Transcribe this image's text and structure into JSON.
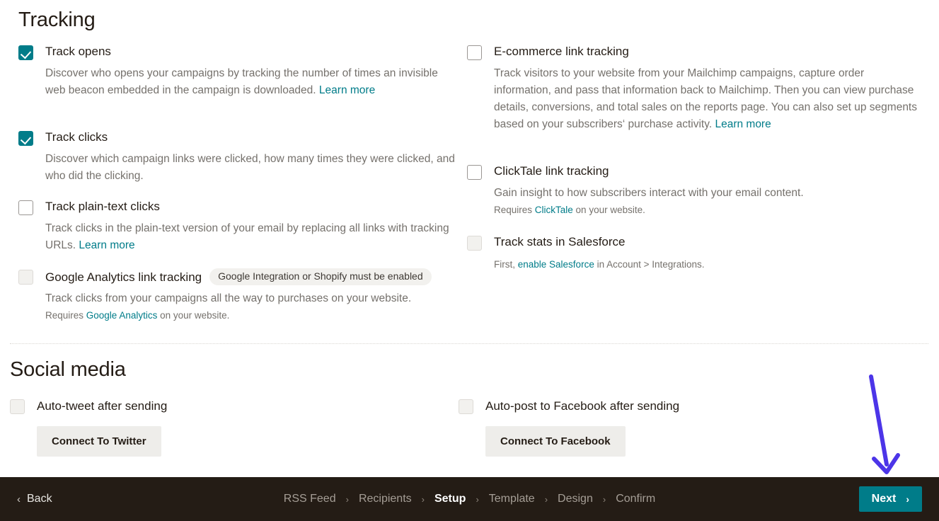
{
  "colors": {
    "accent_teal": "#007c89",
    "link_teal": "#007c89",
    "bottom_bar": "#241c15",
    "annotation_arrow": "#4c35e8",
    "badge_bg": "#f2f1ee"
  },
  "tracking": {
    "title": "Tracking",
    "left_options": [
      {
        "label": "Track opens",
        "checked": true,
        "desc_before": "Discover who opens your campaigns by tracking the number of times an invisible web beacon embedded in the campaign is downloaded. ",
        "link": "Learn more",
        "desc_after": ""
      },
      {
        "label": "Track clicks",
        "checked": true,
        "desc_before": "Discover which campaign links were clicked, how many times they were clicked, and who did the clicking.",
        "link": "",
        "desc_after": ""
      },
      {
        "label": "Track plain-text clicks",
        "checked": false,
        "desc_before": "Track clicks in the plain-text version of your email by replacing all links with tracking URLs. ",
        "link": "Learn more",
        "desc_after": ""
      },
      {
        "label": "Google Analytics link tracking",
        "checked": false,
        "disabled": true,
        "badge": "Google Integration or Shopify must be enabled",
        "desc_before": "Track clicks from your campaigns all the way to purchases on your website.",
        "link": "",
        "desc_after": "",
        "sub_before": "Requires ",
        "sub_link": "Google Analytics",
        "sub_after": " on your website."
      }
    ],
    "right_options": [
      {
        "label": "E-commerce link tracking",
        "checked": false,
        "desc_before": "Track visitors to your website from your Mailchimp campaigns, capture order information, and pass that information back to Mailchimp. Then you can view purchase details, conversions, and total sales on the reports page. You can also set up segments based on your subscribers‘ purchase activity. ",
        "link": "Learn more",
        "desc_after": ""
      },
      {
        "label": "ClickTale link tracking",
        "checked": false,
        "desc_before": "Gain insight to how subscribers interact with your email content.",
        "link": "",
        "desc_after": "",
        "sub_before": "Requires ",
        "sub_link": "ClickTale",
        "sub_after": " on your website."
      },
      {
        "label": "Track stats in Salesforce",
        "checked": false,
        "disabled": true,
        "desc_before": "",
        "link": "",
        "desc_after": "",
        "sub_before": "First, ",
        "sub_link": "enable Salesforce",
        "sub_after": " in Account > Integrations."
      }
    ]
  },
  "social": {
    "title": "Social media",
    "twitter": {
      "label": "Auto-tweet after sending",
      "checked": false,
      "button": "Connect To Twitter"
    },
    "facebook": {
      "label": "Auto-post to Facebook after sending",
      "checked": false,
      "button": "Connect To Facebook"
    }
  },
  "bottom_bar": {
    "back_label": "Back",
    "back_chevron": "‹",
    "steps": [
      {
        "label": "RSS Feed",
        "active": false
      },
      {
        "label": "Recipients",
        "active": false
      },
      {
        "label": "Setup",
        "active": true
      },
      {
        "label": "Template",
        "active": false
      },
      {
        "label": "Design",
        "active": false
      },
      {
        "label": "Confirm",
        "active": false
      }
    ],
    "step_separator": "›",
    "next_label": "Next",
    "next_chevron": "›"
  }
}
